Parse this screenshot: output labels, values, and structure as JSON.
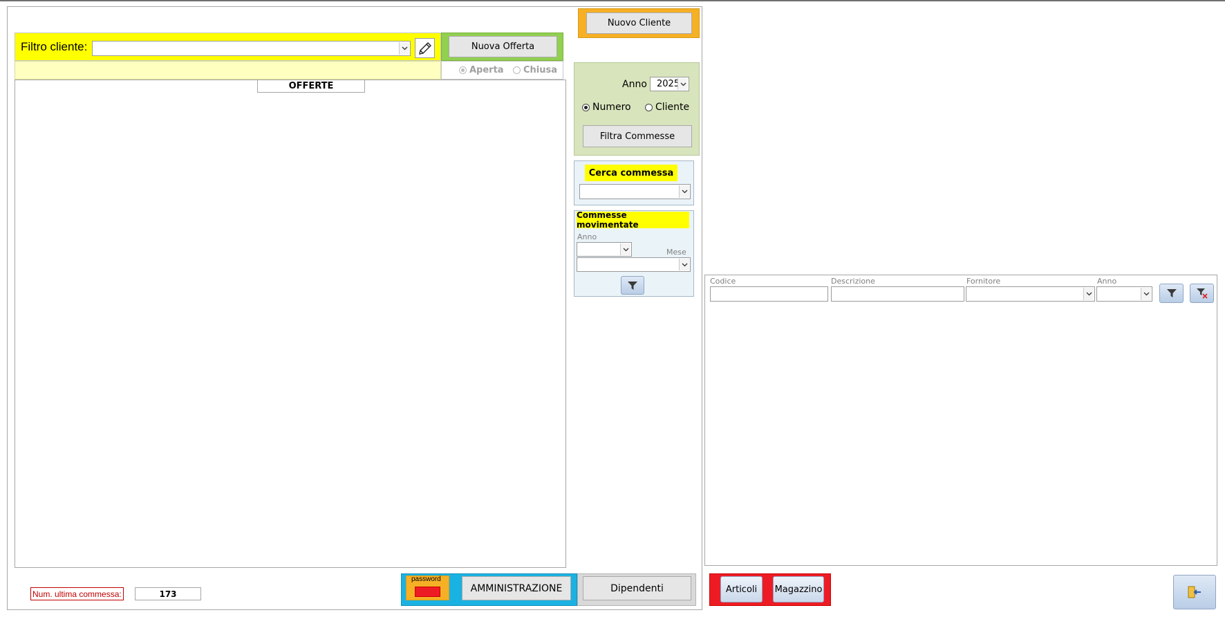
{
  "window": {
    "nuovo_cliente": "Nuovo Cliente",
    "nuova_offerta": "Nuova Offerta"
  },
  "filtro": {
    "label": "Filtro cliente:",
    "value": ""
  },
  "stato_offerta": {
    "options": [
      "Aperta",
      "Chiusa"
    ],
    "selected": "Aperta"
  },
  "offerte": {
    "header": "OFFERTE"
  },
  "commesse_filter": {
    "anno_label": "Anno",
    "anno_value": "2025",
    "order_options": [
      "Numero",
      "Cliente"
    ],
    "order_selected": "Numero",
    "filtra_button": "Filtra Commesse"
  },
  "cerca_commessa": {
    "title": "Cerca commessa",
    "value": ""
  },
  "commesse_movimentate": {
    "title": "Commesse movimentate",
    "anno_label": "Anno",
    "mese_label": "Mese"
  },
  "footer": {
    "num_ultima_label": "Num. ultima commessa:",
    "num_ultima_value": "173",
    "password_label": "password",
    "amministrazione": "AMMINISTRAZIONE",
    "dipendenti": "Dipendenti"
  },
  "articoli_filter": {
    "columns": [
      "Codice",
      "Descrizione",
      "Fornitore",
      "Anno"
    ]
  },
  "bottom_right": {
    "articoli": "Articoli",
    "magazzino": "Magazzino"
  },
  "colors": {
    "yellow": "#ffff00",
    "light_yellow": "#ffffc0",
    "green_panel": "#d8e4bc",
    "orange": "#f6b026",
    "blue_panel": "#eaf3f8",
    "cyan": "#1ab2e2",
    "red": "#ed1c24"
  }
}
